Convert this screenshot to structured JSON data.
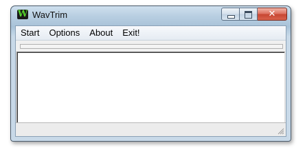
{
  "window": {
    "title": "WavTrim",
    "icon": "wavtrim-w-icon",
    "icon_letter": "W",
    "accent": "#55d32b"
  },
  "menu": {
    "items": [
      {
        "label": "Start"
      },
      {
        "label": "Options"
      },
      {
        "label": "About"
      },
      {
        "label": "Exit!"
      }
    ]
  },
  "progress": {
    "value": 0
  },
  "memo": {
    "text": ""
  },
  "status": {
    "text": ""
  }
}
